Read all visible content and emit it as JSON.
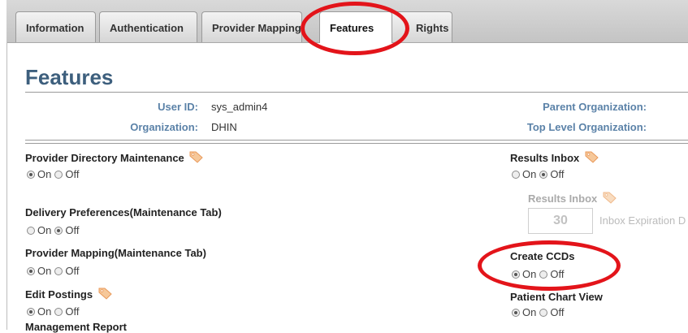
{
  "tabs": [
    {
      "label": "Information"
    },
    {
      "label": "Authentication"
    },
    {
      "label": "Provider Mapping"
    },
    {
      "label": "Features"
    },
    {
      "label": "Rights"
    }
  ],
  "page": {
    "title": "Features"
  },
  "info": {
    "user_id_label": "User ID:",
    "user_id_value": "sys_admin4",
    "organization_label": "Organization:",
    "organization_value": "DHIN",
    "parent_org_label": "Parent Organization:",
    "top_org_label": "Top Level Organization:"
  },
  "radio_labels": {
    "on": "On",
    "off": "Off"
  },
  "features_left": [
    {
      "label": "Provider Directory Maintenance",
      "value": "On",
      "has_tag_icon": true
    },
    {
      "label": "Delivery Preferences(Maintenance Tab)",
      "value": "Off",
      "has_tag_icon": false
    },
    {
      "label": "Provider Mapping(Maintenance Tab)",
      "value": "On",
      "has_tag_icon": false
    },
    {
      "label": "Edit Postings",
      "value": "On",
      "has_tag_icon": true
    },
    {
      "label": "Management Report",
      "value": "",
      "has_tag_icon": false
    }
  ],
  "features_right": [
    {
      "label": "Results Inbox",
      "value": "Off",
      "has_tag_icon": true
    },
    {
      "label": "Create CCDs",
      "value": "On",
      "has_tag_icon": false
    },
    {
      "label": "Patient Chart View",
      "value": "On",
      "has_tag_icon": false
    }
  ],
  "results_inbox_sub": {
    "label": "Results Inbox",
    "value": "30",
    "suffix": "Inbox Expiration D"
  },
  "colors": {
    "highlight_ellipse": "#e3141a",
    "title": "#3d5f7d",
    "info_label": "#5b82a8",
    "disabled_text": "#aaaaaa"
  },
  "icons": {
    "tag": "tag-icon"
  }
}
